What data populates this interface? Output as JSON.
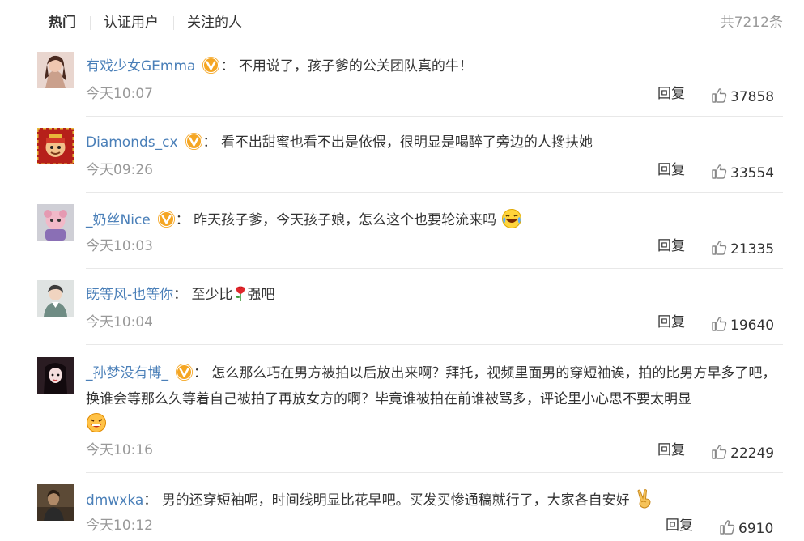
{
  "tabs": [
    {
      "label": "热门",
      "active": true
    },
    {
      "label": "认证用户",
      "active": false
    },
    {
      "label": "关注的人",
      "active": false
    }
  ],
  "total_count": "共7212条",
  "reply_label": "回复",
  "colors": {
    "username": "#4a7fb8",
    "badge": "#f5a623",
    "muted": "#999999"
  },
  "comments": [
    {
      "username": "有戏少女GEmma",
      "verified": true,
      "separator": "：",
      "text": "不用说了，孩子爹的公关团队真的牛！",
      "time": "今天10:07",
      "likes": "37858"
    },
    {
      "username": "Diamonds_cx",
      "verified": true,
      "separator": "：",
      "text": "看不出甜蜜也看不出是依偎，很明显是喝醉了旁边的人搀扶她",
      "time": "今天09:26",
      "likes": "33554"
    },
    {
      "username": "_奶丝Nice",
      "verified": true,
      "separator": "：",
      "text": "昨天孩子爹，今天孩子娘，怎么这个也要轮流来吗",
      "emoji": "laugh-cry-emoji",
      "time": "今天10:03",
      "likes": "21335"
    },
    {
      "username": "既等风-也等你",
      "verified": false,
      "separator": "：",
      "text_before": "至少比",
      "emoji": "flower-emoji",
      "text_after": "强吧",
      "time": "今天10:04",
      "likes": "19640"
    },
    {
      "username": "_孙梦没有博_",
      "verified": true,
      "separator": "：",
      "text": "怎么那么巧在男方被拍以后放出来啊？拜托，视频里面男的穿短袖诶，拍的比男方早多了吧，换谁会等那么久等着自己被拍了再放女方的啊？毕竟谁被拍在前谁被骂多，评论里小心思不要太明显",
      "emoji": "grin-emoji",
      "time": "今天10:16",
      "likes": "22249"
    },
    {
      "username": "dmwxka",
      "verified": false,
      "separator": "：",
      "text": "男的还穿短袖呢，时间线明显比花早吧。买发买惨通稿就行了，大家各自安好",
      "emoji": "victory-hand-emoji",
      "time": "今天10:12",
      "likes": "6910"
    }
  ]
}
